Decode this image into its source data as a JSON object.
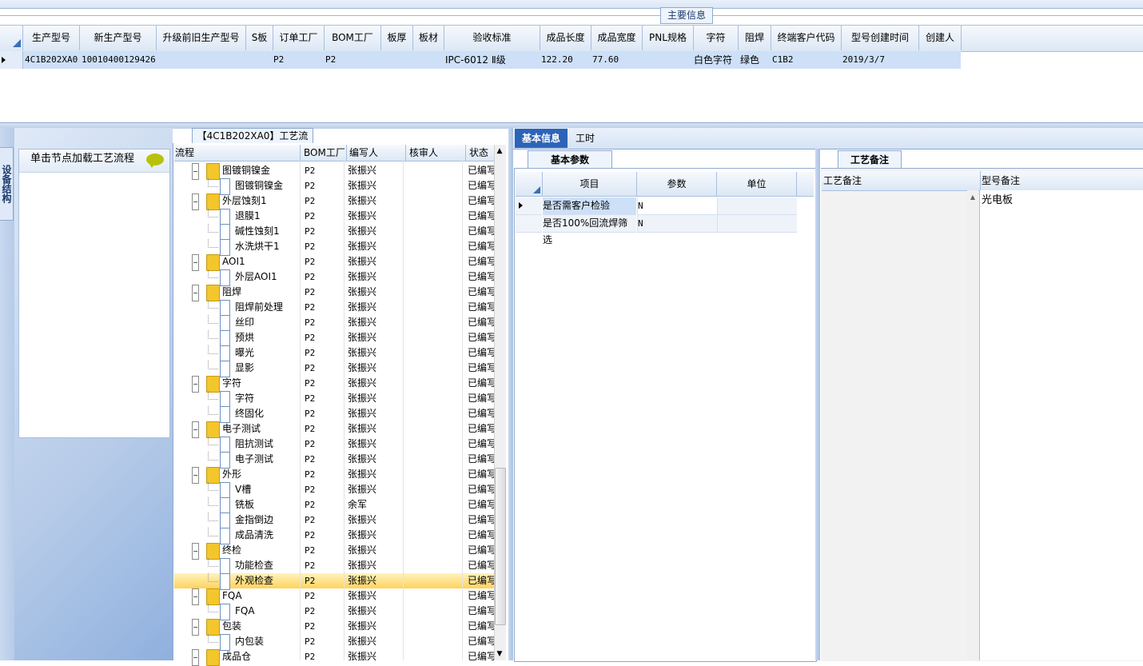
{
  "main_info_tab": "主要信息",
  "product_grid": {
    "columns": [
      "生产型号",
      "新生产型号",
      "升级前旧生产型号",
      "S板",
      "订单工厂",
      "BOM工厂",
      "板厚",
      "板材",
      "验收标准",
      "成品长度",
      "成品宽度",
      "PNL规格",
      "字符",
      "阻焊",
      "终端客户代码",
      "型号创建时间",
      "创建人"
    ],
    "row": {
      "prod_model": "4C1B202XA0",
      "new_model": "10010400129426",
      "old_model": "",
      "s_board": "",
      "order_factory": "P2",
      "bom_factory": "P2",
      "thickness": "",
      "material": "",
      "standard": "IPC-6012 Ⅱ级",
      "length": "122.20",
      "width": "77.60",
      "pnl": "",
      "char": "白色字符",
      "solder": "绿色",
      "customer_code": "C1B2",
      "created": "2019/3/7",
      "creator": ""
    }
  },
  "left_panel": {
    "vertical_tab": "设备结构",
    "hint": "单击节点加载工艺流程"
  },
  "tree": {
    "title": "【4C1B202XA0】工艺流程",
    "columns": [
      "流程",
      "BOM工厂",
      "编写人",
      "核审人",
      "状态"
    ],
    "rows": [
      {
        "label": "图镀铜镍金",
        "type": "folder",
        "factory": "P2",
        "writer": "张振兴",
        "status": "已编写"
      },
      {
        "label": "图镀铜镍金",
        "type": "doc",
        "factory": "P2",
        "writer": "张振兴",
        "status": "已编写"
      },
      {
        "label": "外层蚀刻1",
        "type": "folder",
        "factory": "P2",
        "writer": "张振兴",
        "status": "已编写"
      },
      {
        "label": "退膜1",
        "type": "doc",
        "factory": "P2",
        "writer": "张振兴",
        "status": "已编写"
      },
      {
        "label": "碱性蚀刻1",
        "type": "doc",
        "factory": "P2",
        "writer": "张振兴",
        "status": "已编写"
      },
      {
        "label": "水洗烘干1",
        "type": "doc",
        "factory": "P2",
        "writer": "张振兴",
        "status": "已编写"
      },
      {
        "label": "AOI1",
        "type": "folder",
        "factory": "P2",
        "writer": "张振兴",
        "status": "已编写"
      },
      {
        "label": "外层AOI1",
        "type": "doc",
        "factory": "P2",
        "writer": "张振兴",
        "status": "已编写"
      },
      {
        "label": "阻焊",
        "type": "folder",
        "factory": "P2",
        "writer": "张振兴",
        "status": "已编写"
      },
      {
        "label": "阻焊前处理",
        "type": "doc",
        "factory": "P2",
        "writer": "张振兴",
        "status": "已编写"
      },
      {
        "label": "丝印",
        "type": "doc",
        "factory": "P2",
        "writer": "张振兴",
        "status": "已编写"
      },
      {
        "label": "预烘",
        "type": "doc",
        "factory": "P2",
        "writer": "张振兴",
        "status": "已编写"
      },
      {
        "label": "曝光",
        "type": "doc",
        "factory": "P2",
        "writer": "张振兴",
        "status": "已编写"
      },
      {
        "label": "显影",
        "type": "doc",
        "factory": "P2",
        "writer": "张振兴",
        "status": "已编写"
      },
      {
        "label": "字符",
        "type": "folder",
        "factory": "P2",
        "writer": "张振兴",
        "status": "已编写"
      },
      {
        "label": "字符",
        "type": "doc",
        "factory": "P2",
        "writer": "张振兴",
        "status": "已编写"
      },
      {
        "label": "终固化",
        "type": "doc",
        "factory": "P2",
        "writer": "张振兴",
        "status": "已编写"
      },
      {
        "label": "电子测试",
        "type": "folder",
        "factory": "P2",
        "writer": "张振兴",
        "status": "已编写"
      },
      {
        "label": "阻抗测试",
        "type": "doc",
        "factory": "P2",
        "writer": "张振兴",
        "status": "已编写"
      },
      {
        "label": "电子测试",
        "type": "doc",
        "factory": "P2",
        "writer": "张振兴",
        "status": "已编写"
      },
      {
        "label": "外形",
        "type": "folder",
        "factory": "P2",
        "writer": "张振兴",
        "status": "已编写"
      },
      {
        "label": "V槽",
        "type": "doc",
        "factory": "P2",
        "writer": "张振兴",
        "status": "已编写"
      },
      {
        "label": "铣板",
        "type": "doc",
        "factory": "P2",
        "writer": "余军",
        "status": "已编写"
      },
      {
        "label": "金指倒边",
        "type": "doc",
        "factory": "P2",
        "writer": "张振兴",
        "status": "已编写"
      },
      {
        "label": "成品清洗",
        "type": "doc",
        "factory": "P2",
        "writer": "张振兴",
        "status": "已编写"
      },
      {
        "label": "终检",
        "type": "folder",
        "factory": "P2",
        "writer": "张振兴",
        "status": "已编写"
      },
      {
        "label": "功能检查",
        "type": "doc",
        "factory": "P2",
        "writer": "张振兴",
        "status": "已编写"
      },
      {
        "label": "外观检查",
        "type": "doc",
        "factory": "P2",
        "writer": "张振兴",
        "status": "已编写",
        "selected": true
      },
      {
        "label": "FQA",
        "type": "folder",
        "factory": "P2",
        "writer": "张振兴",
        "status": "已编写"
      },
      {
        "label": "FQA",
        "type": "doc",
        "factory": "P2",
        "writer": "张振兴",
        "status": "已编写"
      },
      {
        "label": "包装",
        "type": "folder",
        "factory": "P2",
        "writer": "张振兴",
        "status": "已编写"
      },
      {
        "label": "内包装",
        "type": "doc",
        "factory": "P2",
        "writer": "张振兴",
        "status": "已编写"
      },
      {
        "label": "成品仓",
        "type": "folder",
        "factory": "P2",
        "writer": "张振兴",
        "status": "已编写"
      }
    ]
  },
  "right_panel": {
    "tabs": [
      "基本信息",
      "工时"
    ],
    "sub_tab": "基本参数",
    "param_columns": [
      "项目",
      "参数",
      "单位"
    ],
    "params": [
      {
        "item": "是否需客户检验",
        "value": "N",
        "unit": ""
      },
      {
        "item": "是否100%回流焊筛选",
        "value": "N",
        "unit": ""
      }
    ],
    "note_tab": "工艺备注",
    "note_columns": [
      "工艺备注",
      "型号备注"
    ],
    "model_note": "光电板"
  },
  "colors": {
    "selection": "#cde0f7",
    "accent": "#2c64b7",
    "tree_selected": "#ffd35c",
    "folder": "#f3c62c"
  }
}
